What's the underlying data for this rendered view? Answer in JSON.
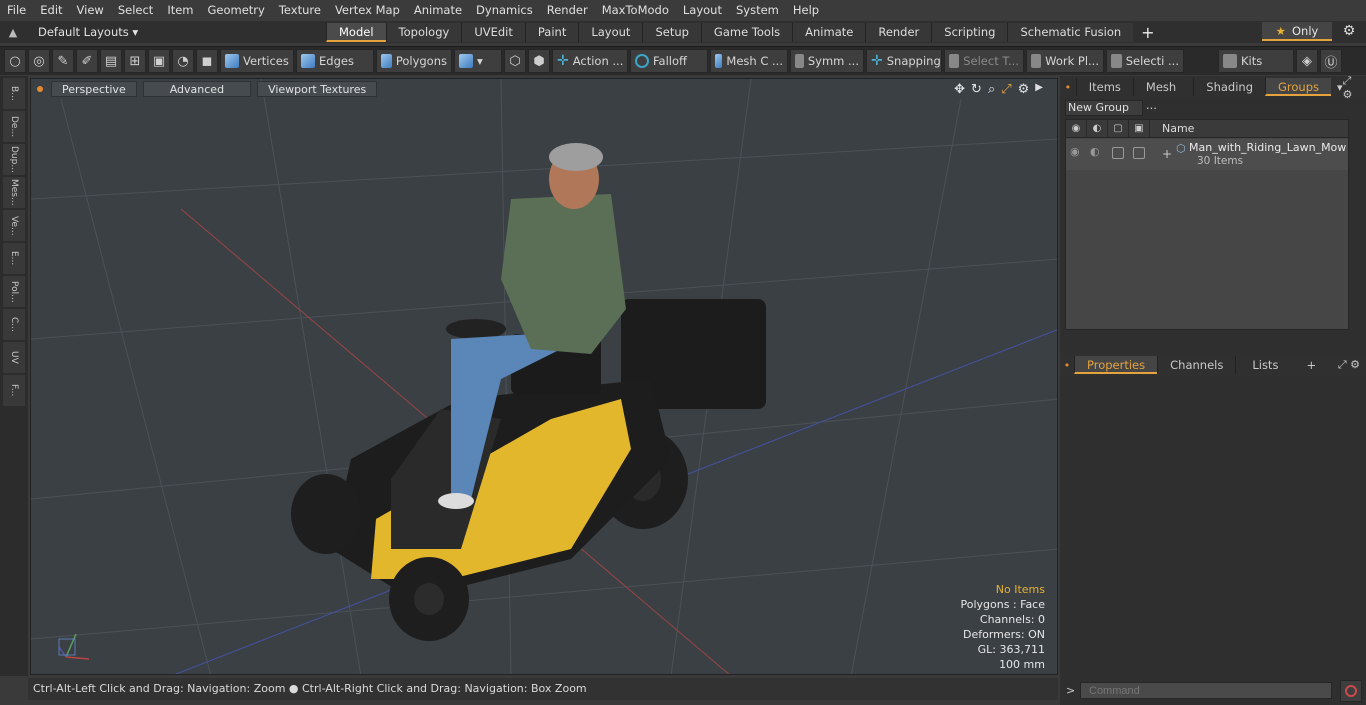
{
  "menu": [
    "File",
    "Edit",
    "View",
    "Select",
    "Item",
    "Geometry",
    "Texture",
    "Vertex Map",
    "Animate",
    "Dynamics",
    "Render",
    "MaxToModo",
    "Layout",
    "System",
    "Help"
  ],
  "layout": {
    "dropdown_label": "Default Layouts",
    "tabs": [
      "Model",
      "Topology",
      "UVEdit",
      "Paint",
      "Layout",
      "Setup",
      "Game Tools",
      "Animate",
      "Render",
      "Scripting",
      "Schematic Fusion"
    ],
    "active_tab": "Model",
    "add_tab": "+",
    "only_label": "Only"
  },
  "toolbar": {
    "vertices": "Vertices",
    "edges": "Edges",
    "polygons": "Polygons",
    "action": "Action ...",
    "falloff": "Falloff",
    "mesh": "Mesh C ...",
    "symm": "Symm ...",
    "snapping": "Snapping",
    "select_t": "Select T...",
    "work_pl": "Work Pl...",
    "selecti": "Selecti ...",
    "kits": "Kits"
  },
  "left_tabs": [
    "B...",
    "De...",
    "Dup...",
    "Mes...",
    "Ve...",
    "E...",
    "Pol...",
    "C...",
    "UV",
    "F..."
  ],
  "viewport": {
    "perspective": "Perspective",
    "advanced": "Advanced",
    "textures": "Viewport Textures",
    "hud": {
      "no_items": "No Items",
      "polygons": "Polygons : Face",
      "channels": "Channels: 0",
      "deformers": "Deformers: ON",
      "gl": "GL: 363,711",
      "scale": "100 mm"
    }
  },
  "status": {
    "text": "Ctrl-Alt-Left Click and Drag: Navigation: Zoom ● Ctrl-Alt-Right Click and Drag: Navigation: Box Zoom"
  },
  "right": {
    "top_tabs": [
      "Items",
      "Mesh ...",
      "Shading",
      "Groups"
    ],
    "active_top_tab": "Groups",
    "new_group": "New Group",
    "name_header": "Name",
    "row_name": "Man_with_Riding_Lawn_Mow ...",
    "row_count": "30 Items",
    "bottom_tabs": [
      "Properties",
      "Channels",
      "Lists"
    ],
    "bottom_add": "+",
    "command_placeholder": "Command"
  },
  "colors": {
    "accent": "#e5a33e",
    "viewport_bg": "#3b4045"
  }
}
